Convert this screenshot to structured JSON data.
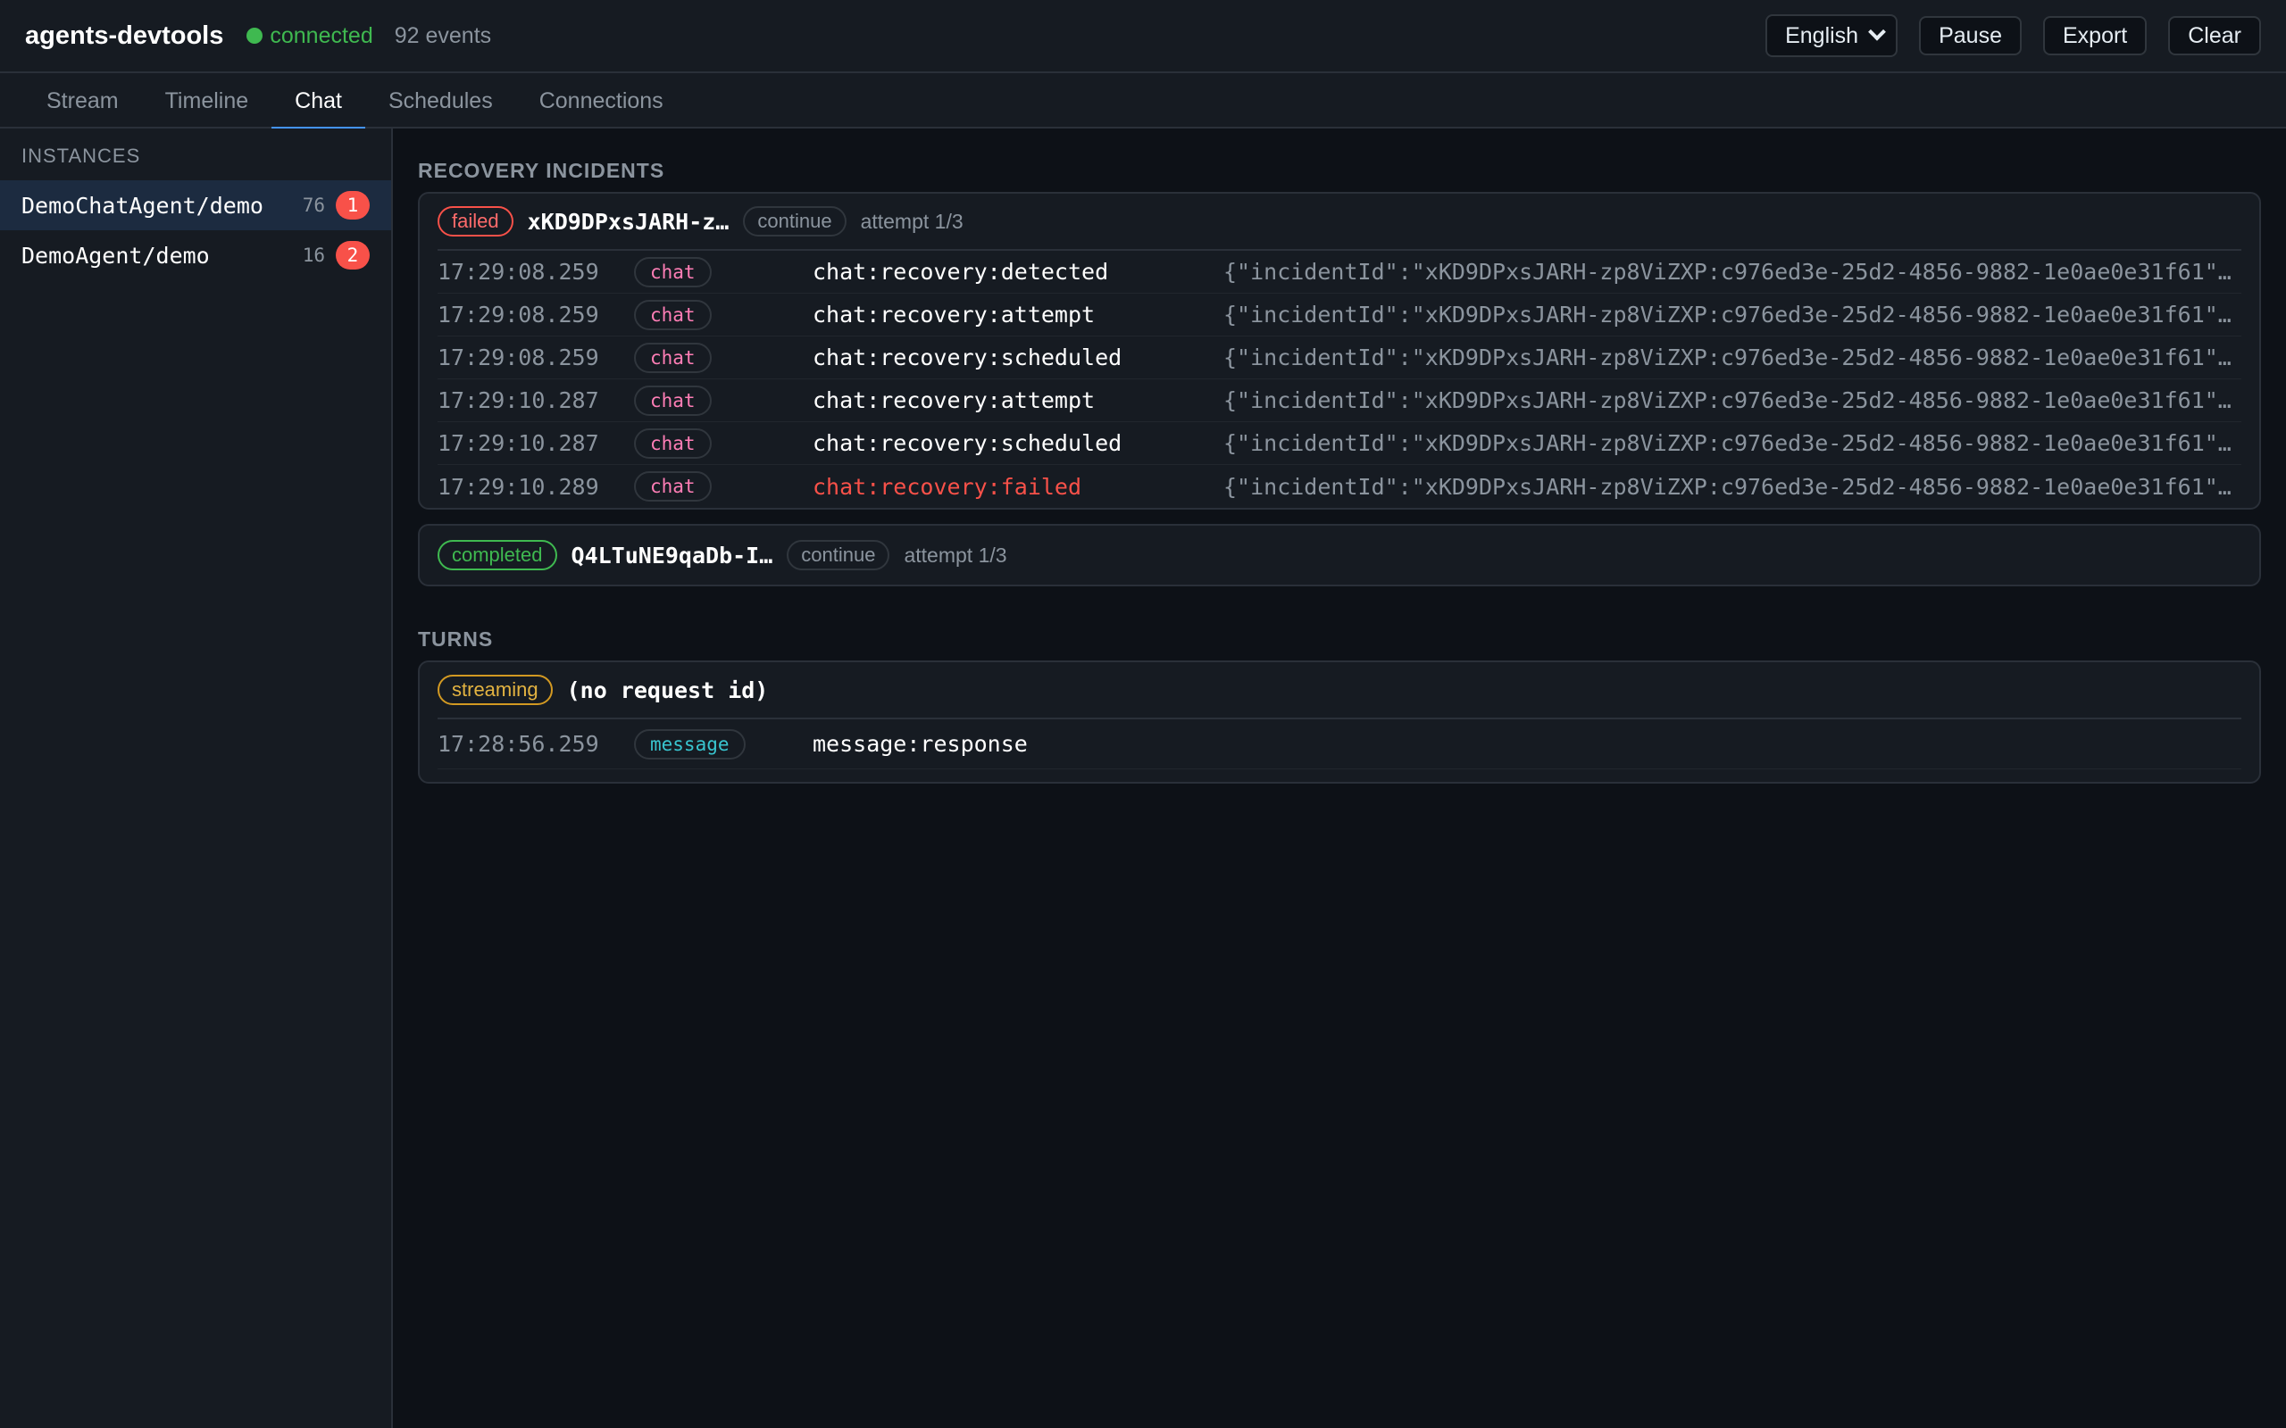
{
  "header": {
    "title": "agents-devtools",
    "status": "connected",
    "events": "92 events",
    "language": "English",
    "pause": "Pause",
    "export": "Export",
    "clear": "Clear",
    "status_color": "#3fb950"
  },
  "tabs": [
    {
      "label": "Stream"
    },
    {
      "label": "Timeline"
    },
    {
      "label": "Chat",
      "active": true
    },
    {
      "label": "Schedules"
    },
    {
      "label": "Connections"
    }
  ],
  "sidebar": {
    "heading": "INSTANCES",
    "items": [
      {
        "name": "DemoChatAgent/demo",
        "count": "76",
        "badge": "1",
        "selected": true
      },
      {
        "name": "DemoAgent/demo",
        "count": "16",
        "badge": "2"
      }
    ]
  },
  "recovery": {
    "title": "RECOVERY INCIDENTS",
    "incidents": [
      {
        "status": "failed",
        "id": "xKD9DPxsJARH-z…",
        "mode": "continue",
        "attempt": "attempt 1/3",
        "rows": [
          {
            "time": "17:29:08.259",
            "tag": "chat",
            "event": "chat:recovery:detected",
            "payload": "{\"incidentId\":\"xKD9DPxsJARH-zp8ViZXP:c976ed3e-25d2-4856-9882-1e0ae0e31f61\",\"r…"
          },
          {
            "time": "17:29:08.259",
            "tag": "chat",
            "event": "chat:recovery:attempt",
            "payload": "{\"incidentId\":\"xKD9DPxsJARH-zp8ViZXP:c976ed3e-25d2-4856-9882-1e0ae0e31f61\",\"r…"
          },
          {
            "time": "17:29:08.259",
            "tag": "chat",
            "event": "chat:recovery:scheduled",
            "payload": "{\"incidentId\":\"xKD9DPxsJARH-zp8ViZXP:c976ed3e-25d2-4856-9882-1e0ae0e31f61\",\"r…"
          },
          {
            "time": "17:29:10.287",
            "tag": "chat",
            "event": "chat:recovery:attempt",
            "payload": "{\"incidentId\":\"xKD9DPxsJARH-zp8ViZXP:c976ed3e-25d2-4856-9882-1e0ae0e31f61\",\"r…"
          },
          {
            "time": "17:29:10.287",
            "tag": "chat",
            "event": "chat:recovery:scheduled",
            "payload": "{\"incidentId\":\"xKD9DPxsJARH-zp8ViZXP:c976ed3e-25d2-4856-9882-1e0ae0e31f61\",\"r…"
          },
          {
            "time": "17:29:10.289",
            "tag": "chat",
            "event": "chat:recovery:failed",
            "payload": "{\"incidentId\":\"xKD9DPxsJARH-zp8ViZXP:c976ed3e-25d2-4856-9882-1e0ae0e31f61\",\"r…",
            "error": true
          }
        ]
      },
      {
        "status": "completed",
        "id": "Q4LTuNE9qaDb-I…",
        "mode": "continue",
        "attempt": "attempt 1/3"
      }
    ]
  },
  "turns": {
    "title": "TURNS",
    "items": [
      {
        "status": "streaming",
        "request": "(no request id)",
        "rows": [
          {
            "time": "17:28:56.259",
            "tag": "message",
            "event": "message:response"
          }
        ]
      }
    ]
  }
}
